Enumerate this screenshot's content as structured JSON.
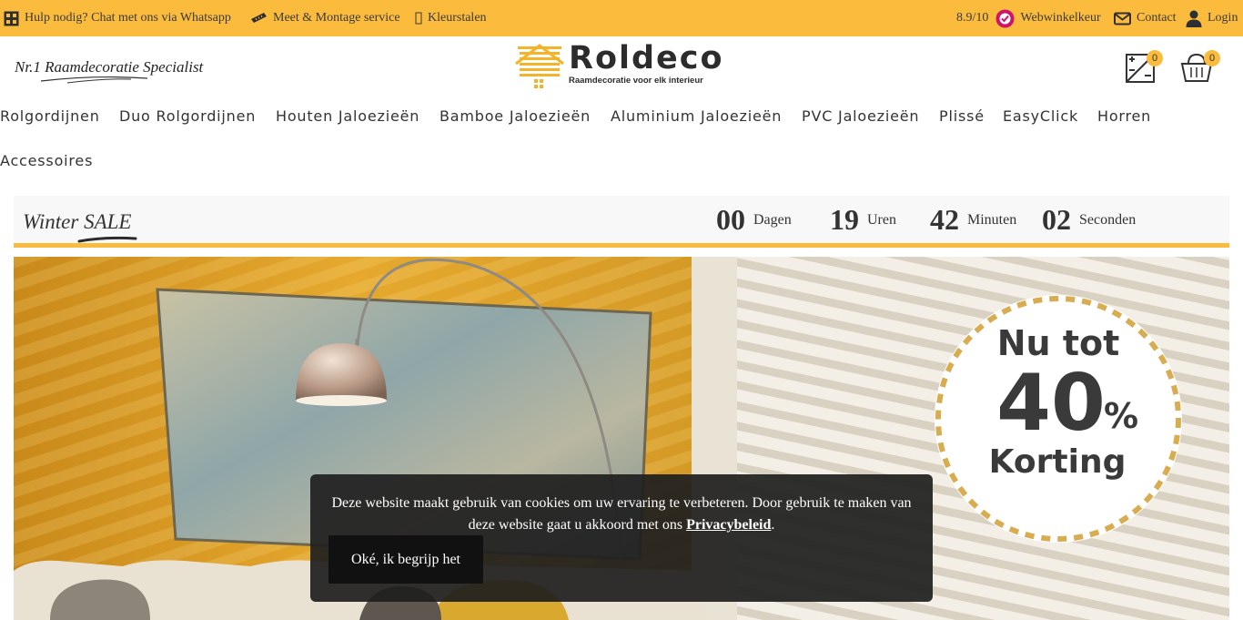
{
  "topbar": {
    "whatsapp": "Hulp nodig? Chat met ons via Whatsapp",
    "measure": "Meet & Montage service",
    "swatches": "Kleurstalen",
    "rating": "8.9/10",
    "review_site": "Webwinkelkeur",
    "contact": "Contact",
    "login": "Login"
  },
  "header": {
    "slogan": "Nr.1 Raamdecoratie Specialist",
    "logo_name": "Roldeco",
    "logo_tagline": "Raamdecoratie voor elk interieur",
    "compare_count": "0",
    "cart_count": "0"
  },
  "nav": {
    "items": [
      "Rolgordijnen",
      "Duo Rolgordijnen",
      "Houten Jaloezieën",
      "Bamboe Jaloezieën",
      "Aluminium Jaloezieën",
      "PVC Jaloezieën",
      "Plissé",
      "EasyClick",
      "Horren",
      "Accessoires"
    ]
  },
  "sale": {
    "title": "Winter SALE",
    "countdown": {
      "days": "00",
      "days_label": "Dagen",
      "hours": "19",
      "hours_label": "Uren",
      "minutes": "42",
      "minutes_label": "Minuten",
      "seconds": "02",
      "seconds_label": "Seconden"
    }
  },
  "hero": {
    "badge_line1": "Nu tot",
    "badge_number": "40",
    "badge_percent": "%",
    "badge_line2": "Korting"
  },
  "cookie": {
    "text": "Deze website maakt gebruik van cookies om uw ervaring te verbeteren. Door gebruik te maken van deze website gaat u akkoord met ons",
    "link": "Privacybeleid",
    "period": ".",
    "button": "Oké, ik begrijp het"
  },
  "colors": {
    "accent": "#fbbc3e",
    "text": "#333333",
    "cookie_bg": "#1e1e1e"
  },
  "icons": [
    "whatsapp-icon",
    "tape-measure-icon",
    "swatch-icon",
    "webwinkelkeur-icon",
    "envelope-icon",
    "user-icon",
    "compare-icon",
    "basket-icon"
  ]
}
